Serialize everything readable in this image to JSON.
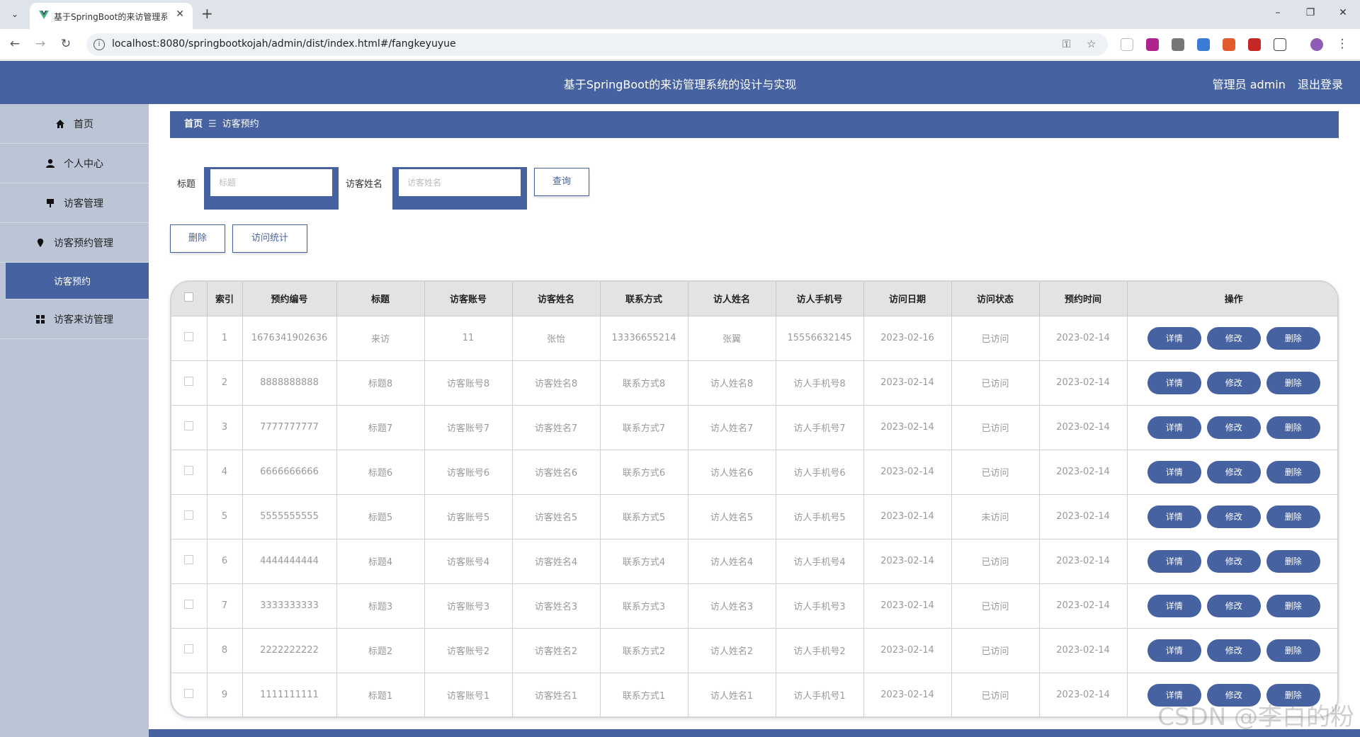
{
  "browser": {
    "tab_title": "基于SpringBoot的来访管理系统",
    "url": "localhost:8080/springbootkojah/admin/dist/index.html#/fangkeyuyue"
  },
  "header": {
    "title": "基于SpringBoot的来访管理系统的设计与实现",
    "user_label": "管理员 admin",
    "logout": "退出登录"
  },
  "sidebar": {
    "items": [
      {
        "label": "首页",
        "icon": "home-icon"
      },
      {
        "label": "个人中心",
        "icon": "user-icon"
      },
      {
        "label": "访客管理",
        "icon": "visitor-icon"
      },
      {
        "label": "访客预约管理",
        "icon": "location-icon"
      },
      {
        "label": "访客来访管理",
        "icon": "grid-icon"
      }
    ],
    "active_sub": "访客预约"
  },
  "breadcrumb": {
    "home": "首页",
    "current": "访客预约"
  },
  "search": {
    "title_label": "标题",
    "title_placeholder": "标题",
    "name_label": "访客姓名",
    "name_placeholder": "访客姓名",
    "query_button": "查询"
  },
  "actions": {
    "delete": "删除",
    "stats": "访问统计"
  },
  "table": {
    "headers": [
      "索引",
      "预约编号",
      "标题",
      "访客账号",
      "访客姓名",
      "联系方式",
      "访人姓名",
      "访人手机号",
      "访问日期",
      "访问状态",
      "预约时间",
      "操作"
    ],
    "op_labels": {
      "detail": "详情",
      "edit": "修改",
      "delete": "删除"
    },
    "rows": [
      [
        "1",
        "1676341902636",
        "来访",
        "11",
        "张怡",
        "13336655214",
        "张翼",
        "15556632145",
        "2023-02-16",
        "已访问",
        "2023-02-14"
      ],
      [
        "2",
        "8888888888",
        "标题8",
        "访客账号8",
        "访客姓名8",
        "联系方式8",
        "访人姓名8",
        "访人手机号8",
        "2023-02-14",
        "已访问",
        "2023-02-14"
      ],
      [
        "3",
        "7777777777",
        "标题7",
        "访客账号7",
        "访客姓名7",
        "联系方式7",
        "访人姓名7",
        "访人手机号7",
        "2023-02-14",
        "已访问",
        "2023-02-14"
      ],
      [
        "4",
        "6666666666",
        "标题6",
        "访客账号6",
        "访客姓名6",
        "联系方式6",
        "访人姓名6",
        "访人手机号6",
        "2023-02-14",
        "已访问",
        "2023-02-14"
      ],
      [
        "5",
        "5555555555",
        "标题5",
        "访客账号5",
        "访客姓名5",
        "联系方式5",
        "访人姓名5",
        "访人手机号5",
        "2023-02-14",
        "未访问",
        "2023-02-14"
      ],
      [
        "6",
        "4444444444",
        "标题4",
        "访客账号4",
        "访客姓名4",
        "联系方式4",
        "访人姓名4",
        "访人手机号4",
        "2023-02-14",
        "已访问",
        "2023-02-14"
      ],
      [
        "7",
        "3333333333",
        "标题3",
        "访客账号3",
        "访客姓名3",
        "联系方式3",
        "访人姓名3",
        "访人手机号3",
        "2023-02-14",
        "已访问",
        "2023-02-14"
      ],
      [
        "8",
        "2222222222",
        "标题2",
        "访客账号2",
        "访客姓名2",
        "联系方式2",
        "访人姓名2",
        "访人手机号2",
        "2023-02-14",
        "已访问",
        "2023-02-14"
      ],
      [
        "9",
        "1111111111",
        "标题1",
        "访客账号1",
        "访客姓名1",
        "联系方式1",
        "访人姓名1",
        "访人手机号1",
        "2023-02-14",
        "已访问",
        "2023-02-14"
      ]
    ]
  },
  "watermark": "CSDN @李白的粉",
  "colors": {
    "primary": "#4662a0",
    "sidebar": "#bcc5d6",
    "header_bg": "#e3e3e3"
  }
}
